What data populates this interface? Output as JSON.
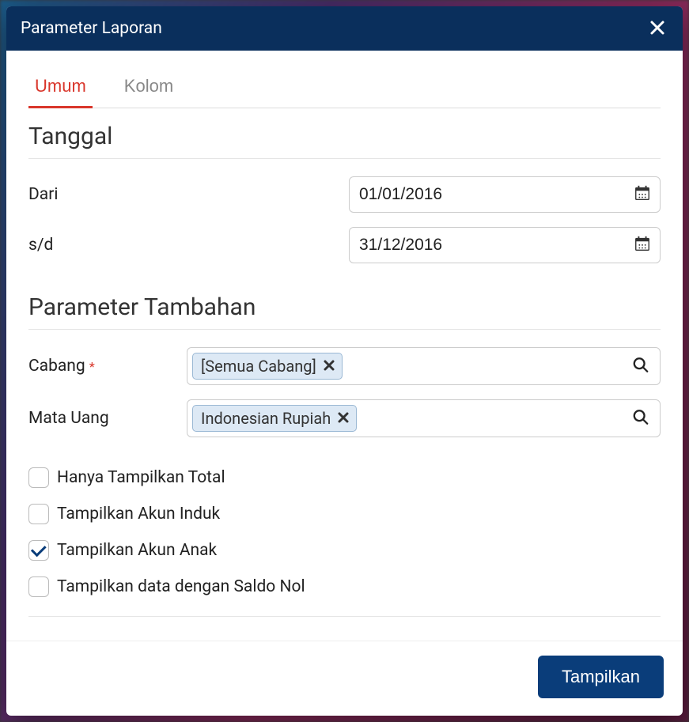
{
  "modal": {
    "title": "Parameter Laporan"
  },
  "tabs": {
    "umum": "Umum",
    "kolom": "Kolom"
  },
  "sections": {
    "tanggal": "Tanggal",
    "parameter_tambahan": "Parameter Tambahan"
  },
  "fields": {
    "dari": {
      "label": "Dari",
      "value": "01/01/2016"
    },
    "sd": {
      "label": "s/d",
      "value": "31/12/2016"
    },
    "cabang": {
      "label": "Cabang",
      "tag": "[Semua Cabang]"
    },
    "mata_uang": {
      "label": "Mata Uang",
      "tag": "Indonesian Rupiah"
    }
  },
  "checkboxes": {
    "hanya_total": {
      "label": "Hanya Tampilkan Total",
      "checked": false
    },
    "akun_induk": {
      "label": "Tampilkan Akun Induk",
      "checked": false
    },
    "akun_anak": {
      "label": "Tampilkan Akun Anak",
      "checked": true
    },
    "saldo_nol": {
      "label": "Tampilkan data dengan Saldo Nol",
      "checked": false
    }
  },
  "footer": {
    "tampilkan": "Tampilkan"
  }
}
